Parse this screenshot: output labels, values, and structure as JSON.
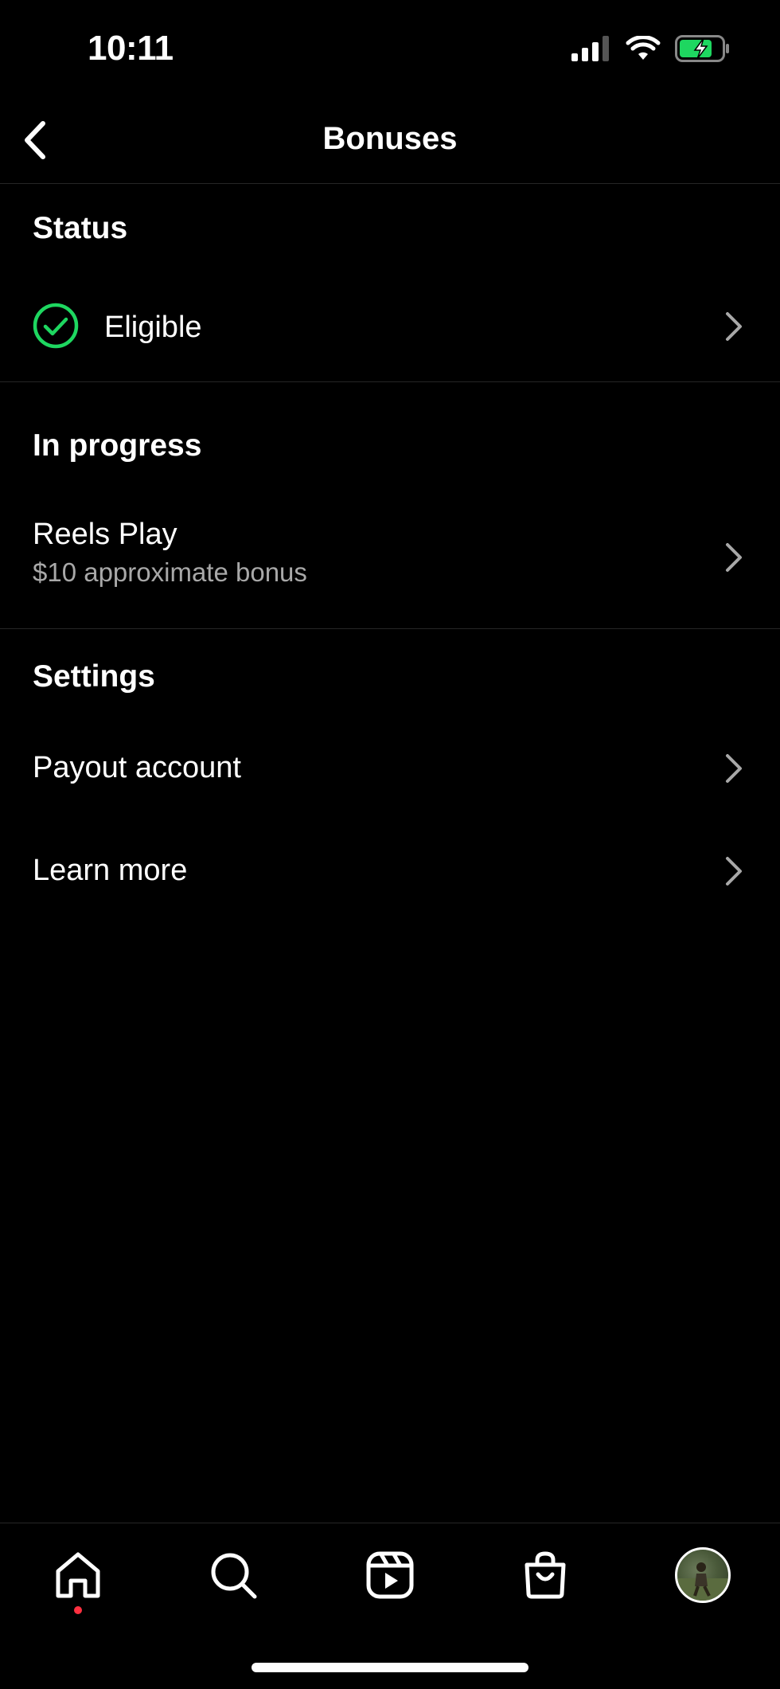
{
  "status_bar": {
    "time": "10:11"
  },
  "header": {
    "title": "Bonuses"
  },
  "sections": {
    "status": {
      "title": "Status",
      "item_label": "Eligible"
    },
    "in_progress": {
      "title": "In progress",
      "item_label": "Reels Play",
      "item_subtitle": "$10 approximate bonus"
    },
    "settings": {
      "title": "Settings",
      "items": [
        {
          "label": "Payout account"
        },
        {
          "label": "Learn more"
        }
      ]
    }
  },
  "bottom_nav": {
    "tabs": [
      "home-icon",
      "search-icon",
      "reels-icon",
      "shop-icon",
      "profile-avatar"
    ]
  },
  "colors": {
    "accent_green": "#1ed760",
    "background": "#000000",
    "notification_dot": "#ff3040"
  }
}
